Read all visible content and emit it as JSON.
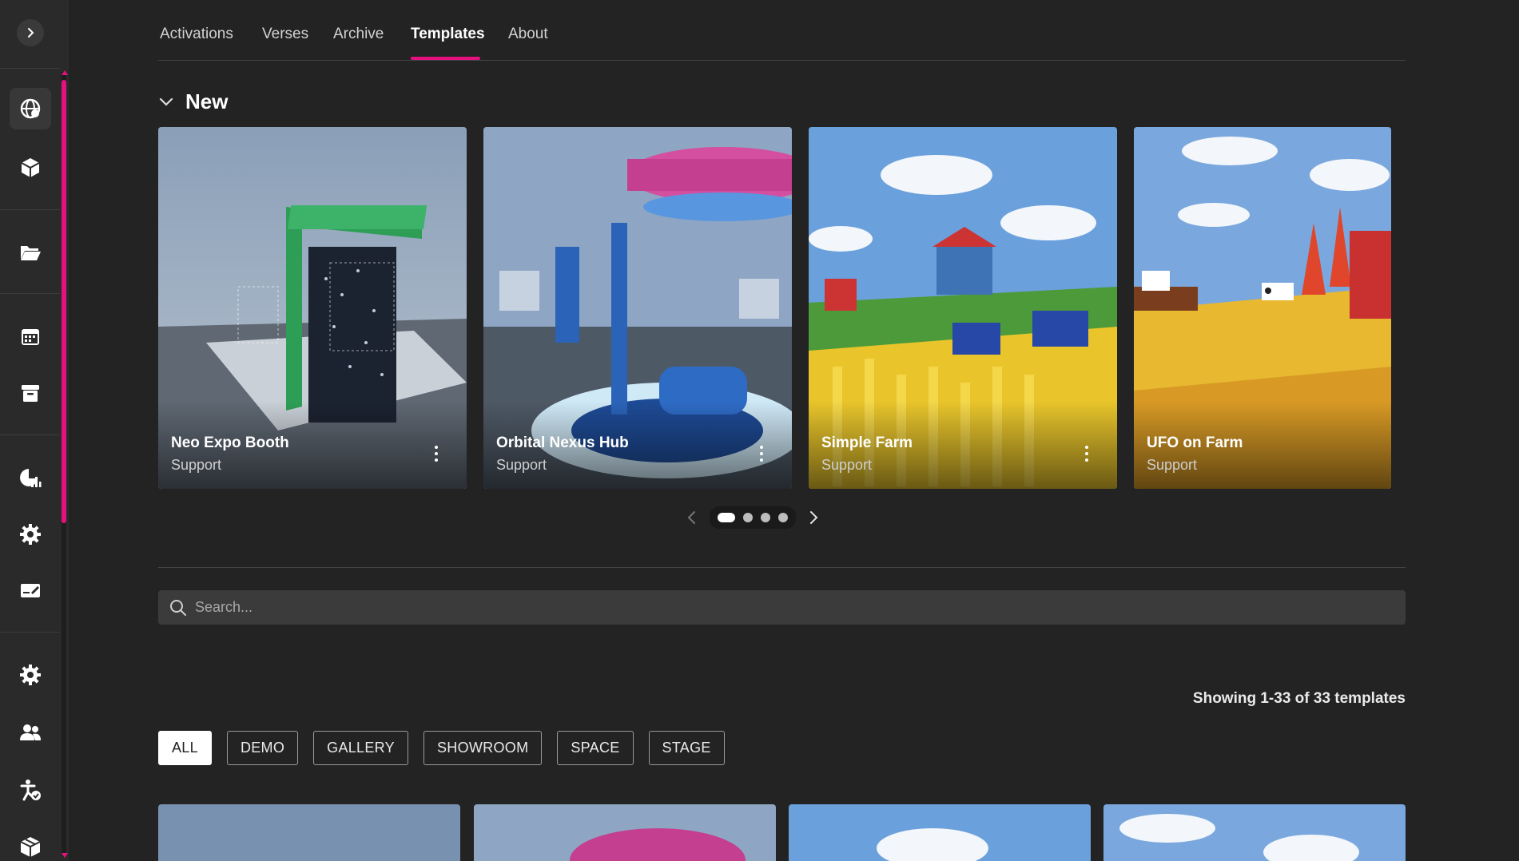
{
  "sidebar": {
    "toggle_icon": "chevron-right-icon",
    "items": [
      {
        "icon": "globe-network-icon",
        "active": true
      },
      {
        "icon": "cube-icon"
      },
      {
        "icon": "folder-open-icon"
      },
      {
        "icon": "calendar-icon"
      },
      {
        "icon": "archive-box-icon"
      },
      {
        "icon": "analytics-icon"
      },
      {
        "icon": "gear-icon"
      },
      {
        "icon": "ticket-edit-icon"
      },
      {
        "icon": "settings-icon"
      },
      {
        "icon": "users-icon"
      },
      {
        "icon": "accessibility-check-icon"
      },
      {
        "icon": "package-icon"
      }
    ],
    "accent": "#e4117f"
  },
  "tabs": [
    {
      "label": "Activations"
    },
    {
      "label": "Verses"
    },
    {
      "label": "Archive"
    },
    {
      "label": "Templates",
      "active": true
    },
    {
      "label": "About"
    }
  ],
  "new_section": {
    "title": "New",
    "cards": [
      {
        "title": "Neo Expo Booth",
        "subtitle": "Support"
      },
      {
        "title": "Orbital Nexus Hub",
        "subtitle": "Support"
      },
      {
        "title": "Simple Farm",
        "subtitle": "Support"
      },
      {
        "title": "UFO on Farm",
        "subtitle": "Support"
      }
    ],
    "pager": {
      "pages": 4,
      "current": 1
    }
  },
  "search": {
    "placeholder": "Search..."
  },
  "results": {
    "count_text": "Showing 1-33 of 33 templates"
  },
  "filters": [
    {
      "label": "ALL",
      "active": true
    },
    {
      "label": "DEMO"
    },
    {
      "label": "GALLERY"
    },
    {
      "label": "SHOWROOM"
    },
    {
      "label": "SPACE"
    },
    {
      "label": "STAGE"
    }
  ]
}
